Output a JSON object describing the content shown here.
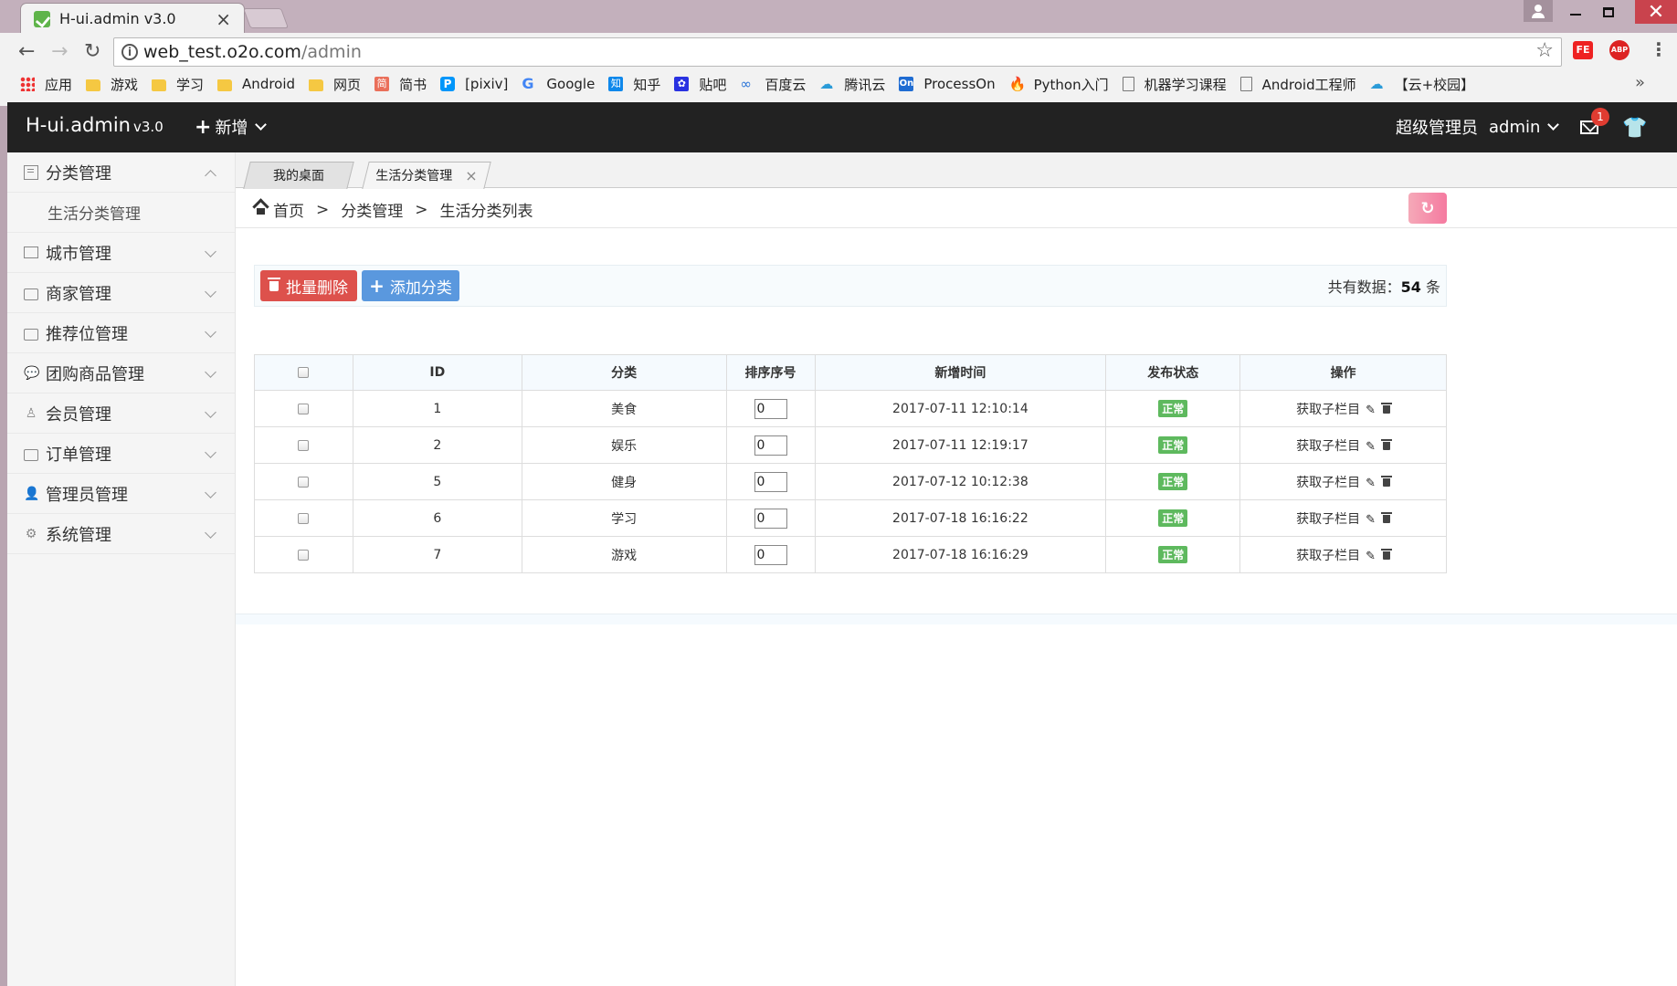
{
  "browser": {
    "tab_title": "H-ui.admin v3.0",
    "tab_close": "×",
    "url_host": "web_test.o2o.com",
    "url_path": "/admin",
    "bookmarks": [
      {
        "label": "应用",
        "icon": "apps-grid-icon"
      },
      {
        "label": "游戏",
        "icon": "folder-icon"
      },
      {
        "label": "学习",
        "icon": "folder-icon"
      },
      {
        "label": "Android",
        "icon": "folder-icon"
      },
      {
        "label": "网页",
        "icon": "folder-icon"
      },
      {
        "label": "简书",
        "icon": "jianshu-icon"
      },
      {
        "label": "[pixiv]",
        "icon": "pixiv-icon"
      },
      {
        "label": "Google",
        "icon": "google-icon"
      },
      {
        "label": "知乎",
        "icon": "zhihu-icon"
      },
      {
        "label": "贴吧",
        "icon": "tieba-icon"
      },
      {
        "label": "百度云",
        "icon": "baiduyun-icon"
      },
      {
        "label": "腾讯云",
        "icon": "tencent-cloud-icon"
      },
      {
        "label": "ProcessOn",
        "icon": "processon-icon"
      },
      {
        "label": "Python入门",
        "icon": "flame-icon"
      },
      {
        "label": "机器学习课程",
        "icon": "document-icon"
      },
      {
        "label": "Android工程师",
        "icon": "document-icon"
      },
      {
        "label": "【云+校园】",
        "icon": "tencent-cloud-icon"
      }
    ],
    "bookmarks_more": "»",
    "ext_fe": "FE",
    "ext_abp": "ABP"
  },
  "app": {
    "logo": "H-ui.admin",
    "version": "v3.0",
    "new_menu": "新增",
    "user_role": "超级管理员",
    "user_name": "admin",
    "mail_badge": "1"
  },
  "sidebar": {
    "items": [
      {
        "label": "分类管理",
        "expanded": true,
        "sub": [
          "生活分类管理"
        ]
      },
      {
        "label": "城市管理"
      },
      {
        "label": "商家管理"
      },
      {
        "label": "推荐位管理"
      },
      {
        "label": "团购商品管理"
      },
      {
        "label": "会员管理"
      },
      {
        "label": "订单管理"
      },
      {
        "label": "管理员管理"
      },
      {
        "label": "系统管理"
      }
    ]
  },
  "tabs": [
    {
      "label": "我的桌面"
    },
    {
      "label": "生活分类管理",
      "close": "×"
    }
  ],
  "breadcrumb": [
    "首页",
    "分类管理",
    "生活分类列表"
  ],
  "breadcrumb_sep": ">",
  "actions": {
    "batch_delete": "批量删除",
    "add_category": "添加分类",
    "total_prefix": "共有数据：",
    "total_count": "54",
    "total_suffix": " 条"
  },
  "table": {
    "headers": [
      "ID",
      "分类",
      "排序序号",
      "新增时间",
      "发布状态",
      "操作"
    ],
    "rows": [
      {
        "id": "1",
        "name": "美食",
        "sort": "0",
        "time": "2017-07-11 12:10:14",
        "status": "正常",
        "op": "获取子栏目"
      },
      {
        "id": "2",
        "name": "娱乐",
        "sort": "0",
        "time": "2017-07-11 12:19:17",
        "status": "正常",
        "op": "获取子栏目"
      },
      {
        "id": "5",
        "name": "健身",
        "sort": "0",
        "time": "2017-07-12 10:12:38",
        "status": "正常",
        "op": "获取子栏目"
      },
      {
        "id": "6",
        "name": "学习",
        "sort": "0",
        "time": "2017-07-18 16:16:22",
        "status": "正常",
        "op": "获取子栏目"
      },
      {
        "id": "7",
        "name": "游戏",
        "sort": "0",
        "time": "2017-07-18 16:16:29",
        "status": "正常",
        "op": "获取子栏目"
      }
    ]
  },
  "colors": {
    "topbar": "#222222",
    "danger": "#dd514c",
    "primary": "#5a98de",
    "status_ok": "#5eb95e"
  }
}
